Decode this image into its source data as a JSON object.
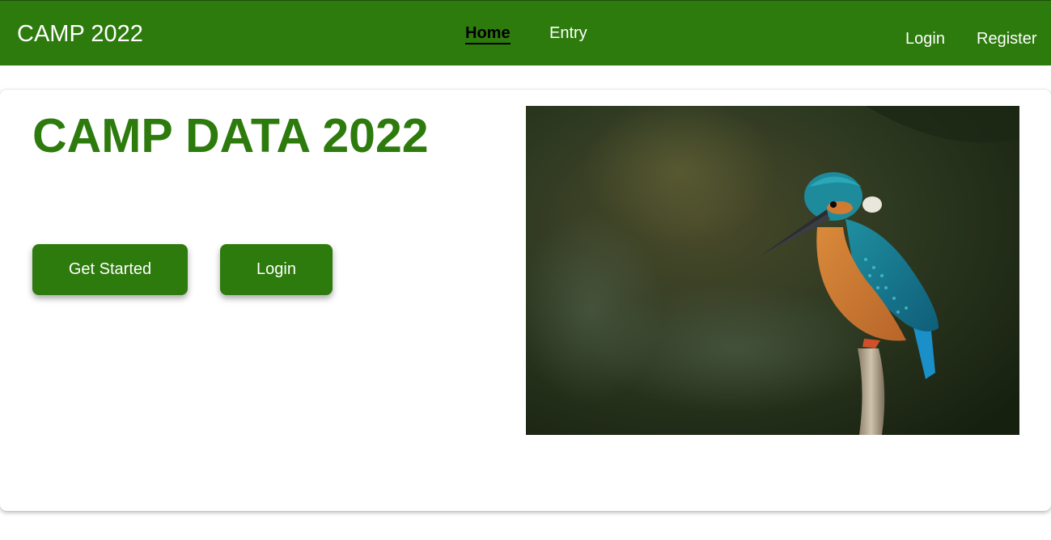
{
  "navbar": {
    "brand": "CAMP 2022",
    "links": [
      {
        "label": "Home",
        "active": true
      },
      {
        "label": "Entry",
        "active": false
      }
    ],
    "auth": {
      "login": "Login",
      "register": "Register"
    }
  },
  "hero": {
    "title": "CAMP DATA 2022",
    "buttons": {
      "get_started": "Get Started",
      "login": "Login"
    }
  },
  "colors": {
    "primary_green": "#2d7a0d",
    "active_link": "#000000",
    "text_light": "#ffffff"
  }
}
